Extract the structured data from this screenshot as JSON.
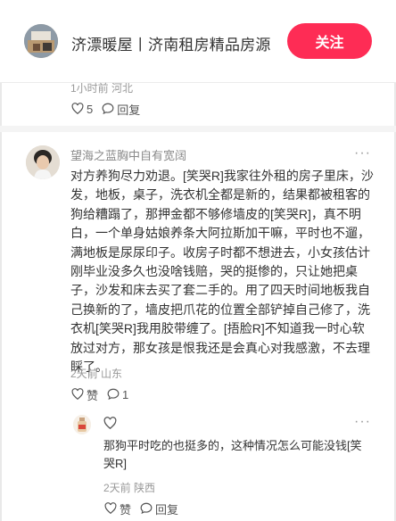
{
  "header": {
    "title": "济漂暖屋丨济南租房精品房源",
    "follow_label": "关注"
  },
  "prev_comment": {
    "meta": "1小时前 河北",
    "like_count": "5",
    "reply_label": "回复"
  },
  "comment": {
    "username": "望海之蓝胸中自有宽阔",
    "more": "···",
    "text": "对方养狗尽力劝退。[笑哭R]我家往外租的房子里床，沙发，地板，桌子，洗衣机全都是新的，结果都被租客的狗给糟蹋了，那押金都不够修墙皮的[笑哭R]，真不明白，一个单身姑娘养条大阿拉斯加干嘛，平时也不遛，满地板是尿尿印子。收房子时都不想进去，小女孩估计刚毕业没多久也没啥钱赔，哭的挺惨的，只让她把桌子，沙发和床去买了套二手的。用了四天时间地板我自己换新的了，墙皮把爪花的位置全部铲掉自己修了，洗衣机[笑哭R]我用胶带缠了。[捂脸R]不知道我一时心软放过对方，那女孩是恨我还是会真心对我感激，不去理睬了。",
    "meta": "2天前 山东",
    "like_label": "赞",
    "reply_count": "1"
  },
  "reply": {
    "more": "···",
    "text": "那狗平时吃的也挺多的，这种情况怎么可能没钱[笑哭R]",
    "meta": "2天前 陕西",
    "like_label": "赞",
    "reply_label": "回复"
  },
  "colors": {
    "accent": "#fe2c55",
    "meta_text": "#999999",
    "username": "#8a8a8a"
  },
  "icons": [
    "heart-icon",
    "comment-bubble-icon",
    "more-icon"
  ]
}
